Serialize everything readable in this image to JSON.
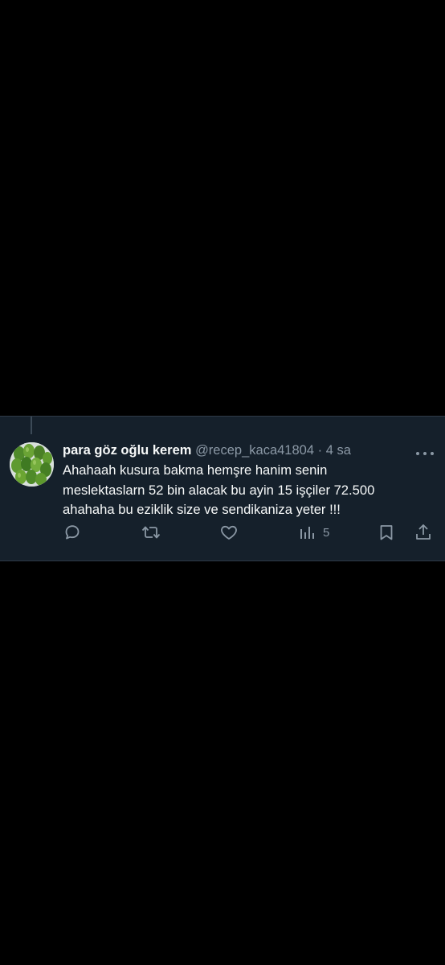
{
  "tweet": {
    "display_name": "para göz oğlu kerem",
    "handle": "@recep_kaca41804",
    "separator": "·",
    "time": "4 sa",
    "text": "Ahahaah kusura bakma hemşre hanim senin\nmeslektaslarn 52 bin alacak bu ayin 15 işçiler 72.500\nahahaha bu eziklik size ve sendikaniza yeter !!!",
    "avatar_icon": "green-fruit-avatar-icon",
    "actions": {
      "reply_icon": "reply-icon",
      "retweet_icon": "retweet-icon",
      "like_icon": "heart-icon",
      "views_icon": "views-bar-chart-icon",
      "views_count": "5",
      "bookmark_icon": "bookmark-icon",
      "share_icon": "share-icon"
    }
  },
  "colors": {
    "page_background": "#000000",
    "tweet_background": "#15202b",
    "primary_text": "#f7f9f9",
    "secondary_text": "#8b98a5"
  }
}
